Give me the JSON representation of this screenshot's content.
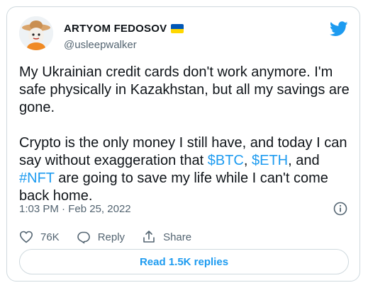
{
  "author": {
    "name": "ARTYOM FEDOSOV",
    "handle": "@usleepwalker",
    "flag_colors": [
      "#0057b7",
      "#ffd700"
    ]
  },
  "tweet": {
    "paragraph1": "My Ukrainian credit cards don't work anymore. I'm safe physically in Kazakhstan, but all my savings are gone.",
    "p2_text1": "Crypto is the only money I still have, and today I can say without exaggeration that ",
    "p2_link1": "$BTC",
    "p2_text2": ", ",
    "p2_link2": "$ETH",
    "p2_text3": ", and ",
    "p2_link3": "#NFT",
    "p2_text4": " are going to save my life while I can't come back home."
  },
  "meta": {
    "time": "1:03 PM",
    "separator": " · ",
    "date": "Feb 25, 2022"
  },
  "actions": {
    "likes": "76K",
    "reply_label": "Reply",
    "share_label": "Share"
  },
  "read_replies_label": "Read 1.5K replies",
  "colors": {
    "link": "#1d9bf0",
    "secondary_text": "#536471",
    "border": "#cfd9de",
    "brand": "#1d9bf0"
  },
  "icons": [
    "avatar",
    "twitter-bird-icon",
    "info-icon",
    "heart-icon",
    "reply-icon",
    "share-icon",
    "ukraine-flag-icon"
  ]
}
